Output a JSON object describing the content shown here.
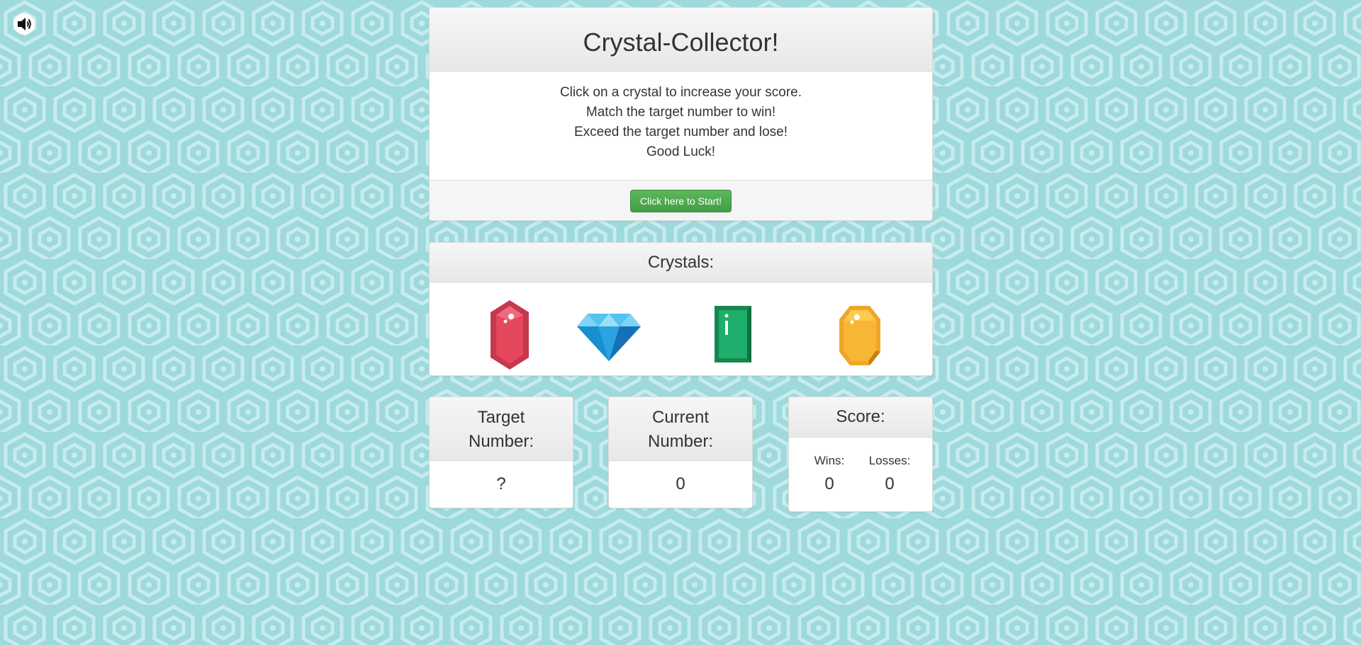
{
  "page": {
    "background_color": "#9ed9dc",
    "pattern_color": "#c7ecee"
  },
  "sound": {
    "icon": "speaker-icon"
  },
  "header": {
    "title": "Crystal-Collector!"
  },
  "instructions": {
    "lines": [
      "Click on a crystal to increase your score.",
      "Match the target number to win!",
      "Exceed the target number and lose!",
      "Good Luck!"
    ]
  },
  "start_button": {
    "label": "Click here to Start!",
    "color": "#5cb85c"
  },
  "crystals": {
    "heading": "Crystals:",
    "items": [
      {
        "name": "red-crystal",
        "color": "#e5475c"
      },
      {
        "name": "blue-diamond",
        "color": "#2fb1e8"
      },
      {
        "name": "green-emerald",
        "color": "#1fae6b"
      },
      {
        "name": "yellow-gem",
        "color": "#f7b633"
      }
    ]
  },
  "target": {
    "heading_line1": "Target",
    "heading_line2": "Number:",
    "value": "?"
  },
  "current": {
    "heading_line1": "Current",
    "heading_line2": "Number:",
    "value": "0"
  },
  "score": {
    "heading": "Score:",
    "wins_label": "Wins:",
    "wins": "0",
    "losses_label": "Losses:",
    "losses": "0"
  }
}
